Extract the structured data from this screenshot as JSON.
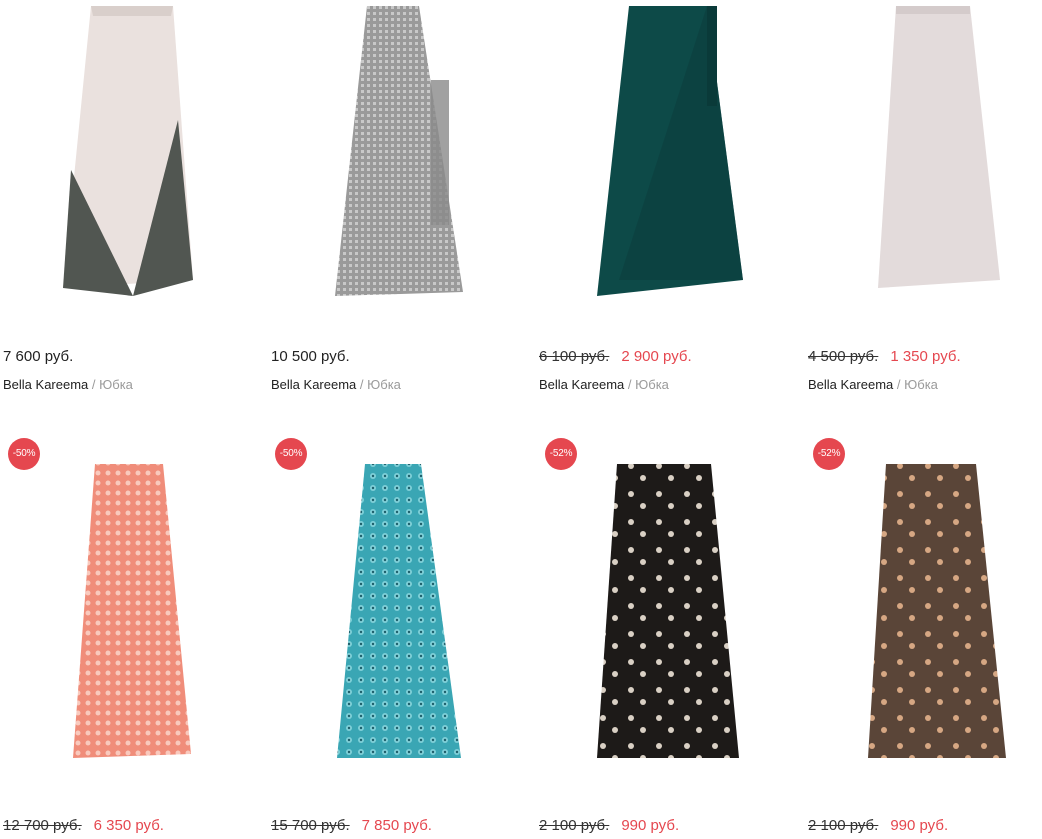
{
  "products": [
    {
      "price": "7 600 руб.",
      "old_price": "",
      "new_price": "",
      "brand": "Bella Kareema",
      "category": "Юбка",
      "badge": "",
      "colors": [
        "#e9e0dd",
        "#4f5550"
      ]
    },
    {
      "price": "10 500 руб.",
      "old_price": "",
      "new_price": "",
      "brand": "Bella Kareema",
      "category": "Юбка",
      "badge": "",
      "colors": [
        "#8b8b8b",
        "#b4b4b4"
      ]
    },
    {
      "price": "",
      "old_price": "6 100 руб.",
      "new_price": "2 900 руб.",
      "brand": "Bella Kareema",
      "category": "Юбка",
      "badge": "",
      "colors": [
        "#0d4a48",
        "#0a3a39"
      ]
    },
    {
      "price": "",
      "old_price": "4 500 руб.",
      "new_price": "1 350 руб.",
      "brand": "Bella Kareema",
      "category": "Юбка",
      "badge": "",
      "colors": [
        "#e3dbdb",
        "#d4cbcb"
      ]
    },
    {
      "price": "",
      "old_price": "12 700 руб.",
      "new_price": "6 350 руб.",
      "brand": "",
      "category": "",
      "badge": "-50%",
      "colors": [
        "#f08d7a",
        "#f6b8a8"
      ]
    },
    {
      "price": "",
      "old_price": "15 700 руб.",
      "new_price": "7 850 руб.",
      "brand": "",
      "category": "",
      "badge": "-50%",
      "colors": [
        "#3aa6b4",
        "#7fd0d8"
      ]
    },
    {
      "price": "",
      "old_price": "2 100 руб.",
      "new_price": "990 руб.",
      "brand": "",
      "category": "",
      "badge": "-52%",
      "colors": [
        "#1d1a18",
        "#d9d0c4"
      ]
    },
    {
      "price": "",
      "old_price": "2 100 руб.",
      "new_price": "990 руб.",
      "brand": "",
      "category": "",
      "badge": "-52%",
      "colors": [
        "#5a4538",
        "#d6a783"
      ]
    }
  ],
  "separator": " / "
}
